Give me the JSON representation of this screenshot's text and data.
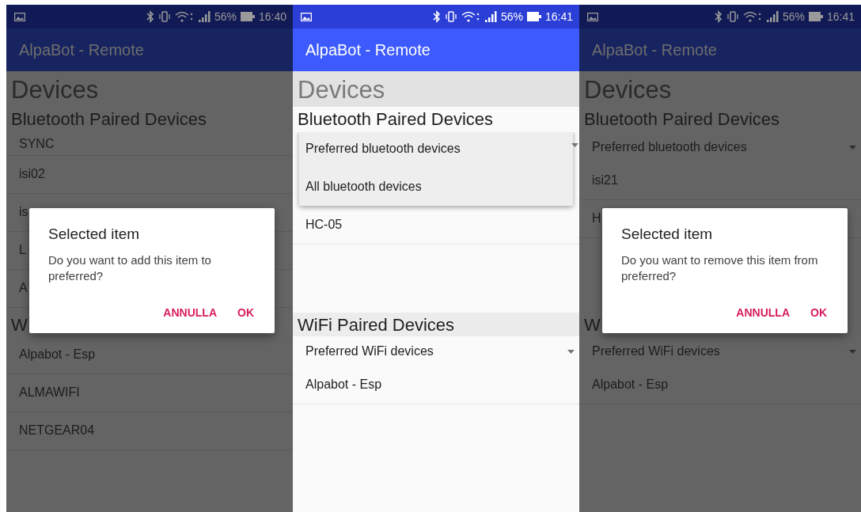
{
  "panels": [
    {
      "status": {
        "battery": "56%",
        "time": "16:40"
      },
      "app_title": "AlpaBot - Remote",
      "page_title": "Devices",
      "bluetooth": {
        "heading": "Bluetooth Paired Devices",
        "items": [
          "SYNC",
          "isi02",
          "is",
          "L",
          "A"
        ]
      },
      "wifi": {
        "heading": "W",
        "items": [
          "Alpabot - Esp",
          "ALMAWIFI",
          "NETGEAR04"
        ]
      },
      "overlay": {
        "kind": "dialog",
        "title": "Selected item",
        "message": "Do you want to add this item to preferred?",
        "buttons": [
          "ANNULLA",
          "OK"
        ]
      }
    },
    {
      "status": {
        "battery": "56%",
        "time": "16:41"
      },
      "app_title": "AlpaBot - Remote",
      "page_title": "Devices",
      "bluetooth": {
        "heading": "Bluetooth Paired Devices",
        "items": [
          "HC-05"
        ]
      },
      "wifi": {
        "heading": "WiFi Paired Devices",
        "spinner": "Preferred WiFi devices",
        "items": [
          "Alpabot - Esp"
        ]
      },
      "overlay": {
        "kind": "dropdown",
        "options": [
          "Preferred bluetooth devices",
          "All bluetooth devices"
        ]
      }
    },
    {
      "status": {
        "battery": "56%",
        "time": "16:41"
      },
      "app_title": "AlpaBot - Remote",
      "page_title": "Devices",
      "bluetooth": {
        "heading": "Bluetooth Paired Devices",
        "spinner": "Preferred bluetooth devices",
        "items": [
          "isi21",
          "H"
        ]
      },
      "wifi": {
        "heading": "W",
        "spinner": "Preferred WiFi devices",
        "items": [
          "Alpabot - Esp"
        ]
      },
      "overlay": {
        "kind": "dialog",
        "title": "Selected item",
        "message": "Do you want to remove this item from preferred?",
        "buttons": [
          "ANNULLA",
          "OK"
        ]
      }
    }
  ]
}
